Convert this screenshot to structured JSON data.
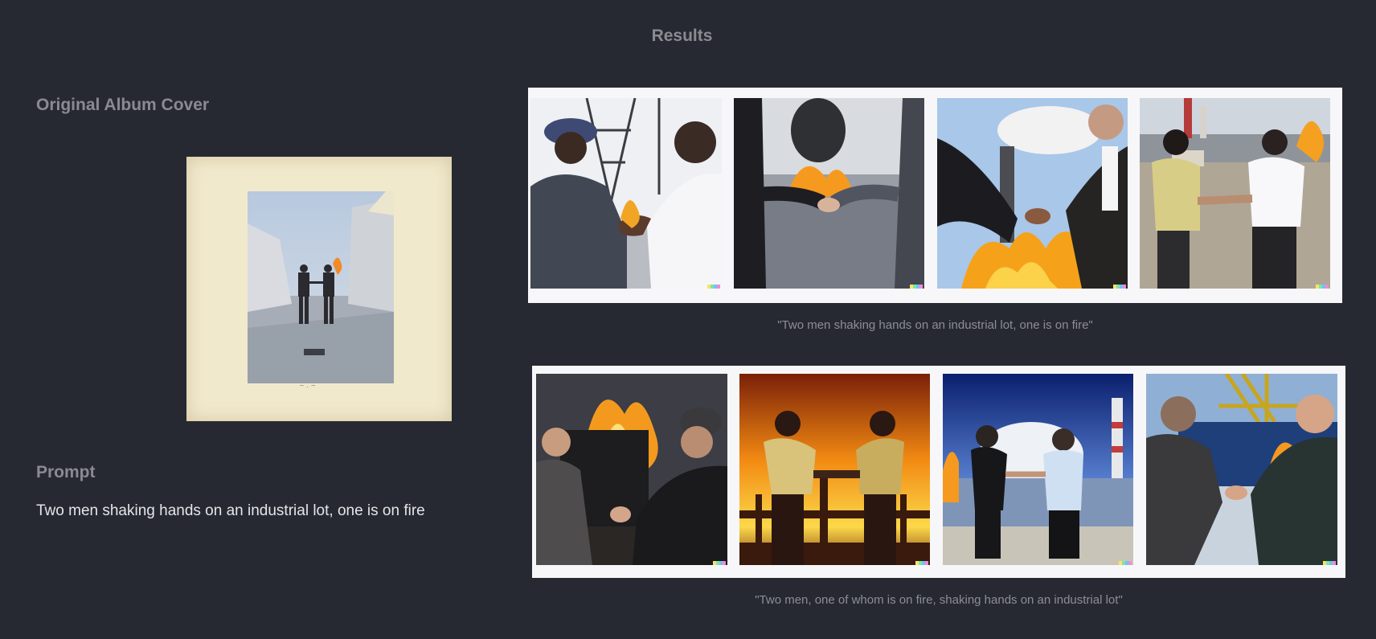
{
  "results_title": "Results",
  "original": {
    "heading": "Original Album Cover",
    "signature": "~ . ~"
  },
  "prompt": {
    "heading": "Prompt",
    "text": "Two men shaking hands on an industrial lot, one is on fire"
  },
  "grids": [
    {
      "caption": "\"Two men shaking hands on an industrial lot, one is on fire\""
    },
    {
      "caption": "\"Two men, one of whom is on fire, shaking hands on an industrial lot\""
    }
  ],
  "colors": {
    "background": "#272932",
    "heading": "#8a8b90",
    "body_text": "#e4e5e8",
    "grid_frame": "#f7f7f9",
    "flame": "#f6a21a"
  }
}
